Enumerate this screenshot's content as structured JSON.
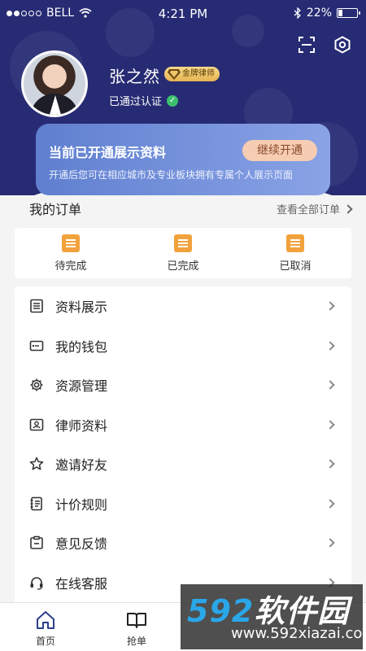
{
  "status_bar": {
    "carrier": "BELL",
    "time": "4:21 PM",
    "battery": "22%",
    "battery_level": 0.22
  },
  "profile": {
    "name": "张之然",
    "badge": "金牌律师",
    "verified": "已通过认证"
  },
  "promo": {
    "title": "当前已开通展示资料",
    "button": "继续开通",
    "desc": "开通后您可在相应城市及专业板块拥有专属个人展示页面"
  },
  "orders": {
    "title": "我的订单",
    "view_all": "查看全部订单",
    "items": [
      {
        "label": "待完成",
        "icon": "pending-order-icon"
      },
      {
        "label": "已完成",
        "icon": "completed-order-icon"
      },
      {
        "label": "已取消",
        "icon": "cancelled-order-icon"
      }
    ]
  },
  "menu": [
    {
      "label": "资料展示",
      "icon": "profile-display-icon"
    },
    {
      "label": "我的钱包",
      "icon": "wallet-icon"
    },
    {
      "label": "资源管理",
      "icon": "gear-icon"
    },
    {
      "label": "律师资料",
      "icon": "id-card-icon"
    },
    {
      "label": "邀请好友",
      "icon": "star-icon"
    },
    {
      "label": "计价规则",
      "icon": "notebook-icon"
    },
    {
      "label": "意见反馈",
      "icon": "feedback-icon"
    },
    {
      "label": "在线客服",
      "icon": "headset-icon"
    }
  ],
  "tabs": [
    {
      "label": "首页",
      "icon": "home-icon"
    },
    {
      "label": "抢单",
      "icon": "book-icon"
    }
  ],
  "watermark": {
    "logo_num": "592",
    "logo_text": "软件园",
    "url": "www.592xiazai.com"
  },
  "colors": {
    "header_bg": "#262b73",
    "accent_orange": "#f2a23c",
    "verified_green": "#3bbf6f"
  }
}
